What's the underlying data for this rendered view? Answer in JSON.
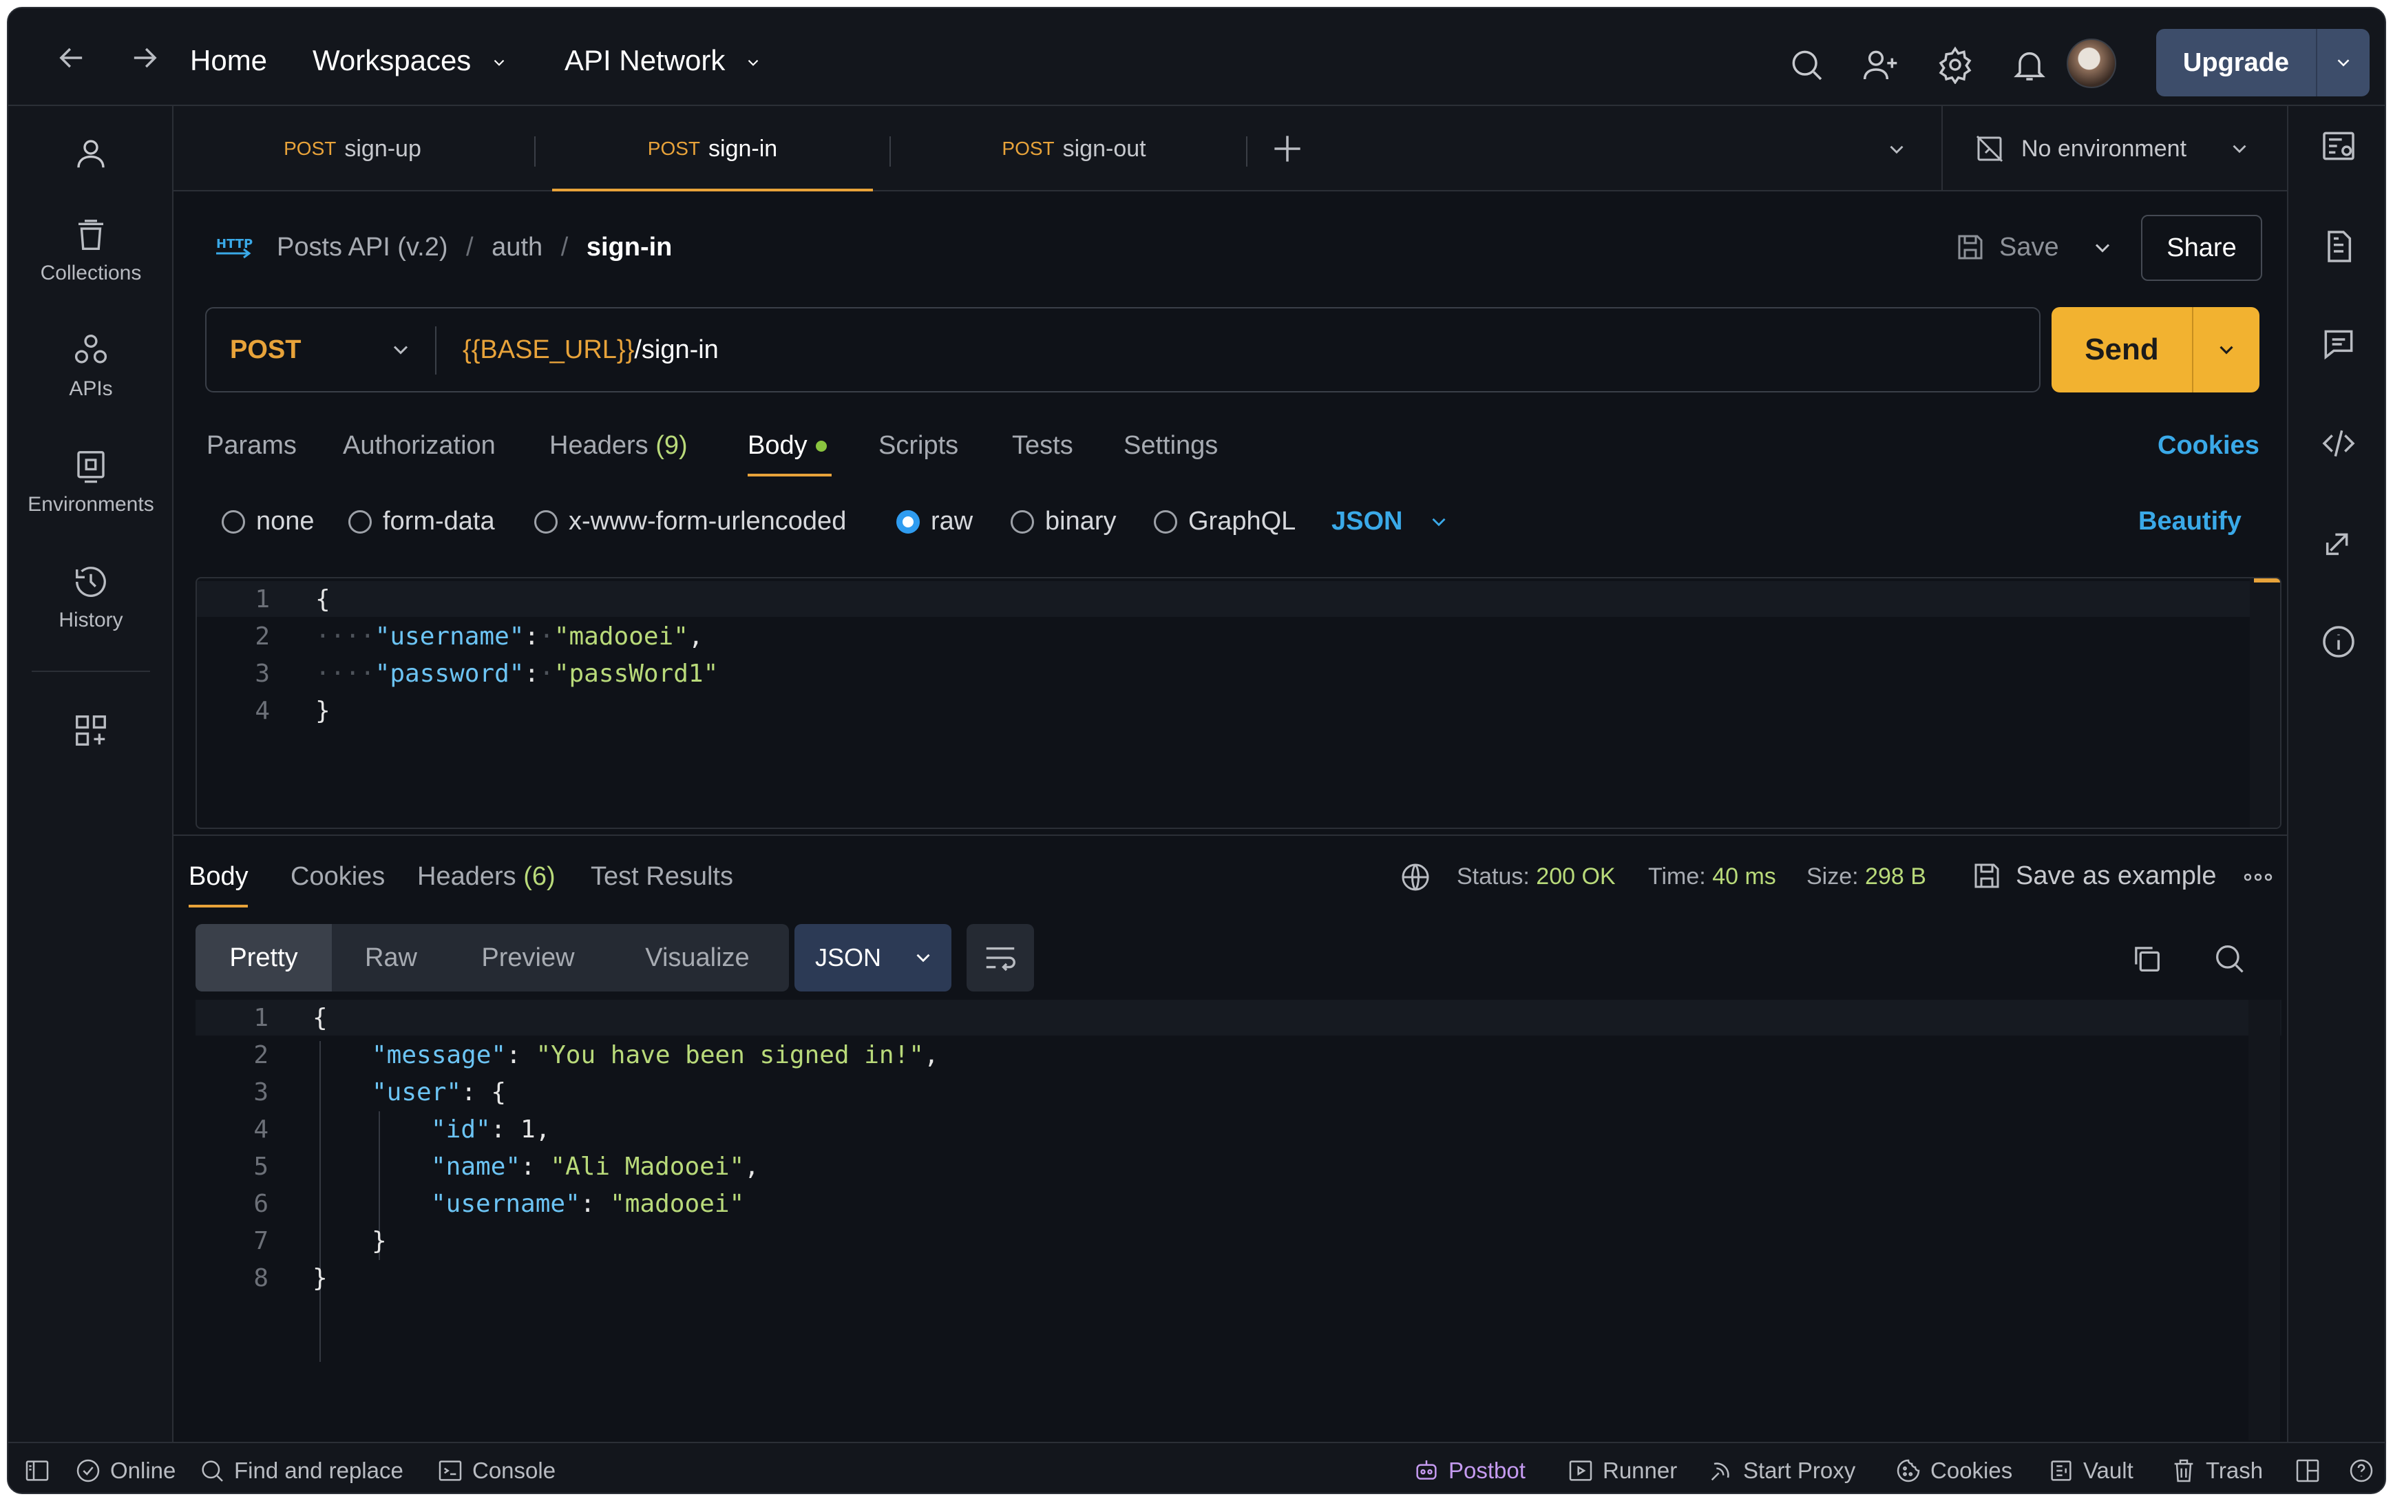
{
  "topbar": {
    "home": "Home",
    "workspaces": "Workspaces",
    "api_network": "API Network",
    "upgrade": "Upgrade"
  },
  "left_rail": {
    "collections": "Collections",
    "apis": "APIs",
    "environments": "Environments",
    "history": "History"
  },
  "tabs": [
    {
      "method": "POST",
      "name": "sign-up",
      "active": false
    },
    {
      "method": "POST",
      "name": "sign-in",
      "active": true
    },
    {
      "method": "POST",
      "name": "sign-out",
      "active": false
    }
  ],
  "environment": "No environment",
  "breadcrumb": {
    "badge": "HTTP",
    "collection": "Posts API (v.2)",
    "folder": "auth",
    "request": "sign-in",
    "sep": "/"
  },
  "actions": {
    "save": "Save",
    "share": "Share"
  },
  "request": {
    "method": "POST",
    "url_var": "{{BASE_URL}}",
    "url_path": "/sign-in",
    "send": "Send"
  },
  "request_tabs": {
    "params": "Params",
    "authorization": "Authorization",
    "headers": "Headers",
    "headers_count": "(9)",
    "body": "Body",
    "scripts": "Scripts",
    "tests": "Tests",
    "settings": "Settings",
    "cookies": "Cookies"
  },
  "body_modes": {
    "none": "none",
    "form_data": "form-data",
    "urlencoded": "x-www-form-urlencoded",
    "raw": "raw",
    "binary": "binary",
    "graphql": "GraphQL",
    "format": "JSON",
    "beautify": "Beautify"
  },
  "request_body": {
    "line_numbers": [
      "1",
      "2",
      "3",
      "4"
    ],
    "open": "{",
    "close": "}",
    "indent_dots": "····",
    "username_key": "\"username\"",
    "username_val": "\"madooei\"",
    "password_key": "\"password\"",
    "password_val": "\"passWord1\"",
    "colon": ":",
    "comma": ","
  },
  "response_tabs": {
    "body": "Body",
    "cookies": "Cookies",
    "headers": "Headers",
    "headers_count": "(6)",
    "test_results": "Test Results"
  },
  "response_meta": {
    "status_label": "Status:",
    "status_value": "200 OK",
    "time_label": "Time:",
    "time_value": "40 ms",
    "size_label": "Size:",
    "size_value": "298 B",
    "save_example": "Save as example"
  },
  "response_view": {
    "pretty": "Pretty",
    "raw": "Raw",
    "preview": "Preview",
    "visualize": "Visualize",
    "format": "JSON"
  },
  "response_body": {
    "line_numbers": [
      "1",
      "2",
      "3",
      "4",
      "5",
      "6",
      "7",
      "8"
    ],
    "l1": "{",
    "message_key": "\"message\"",
    "message_val": "\"You have been signed in!\"",
    "user_key": "\"user\"",
    "user_open": ": {",
    "id_key": "\"id\"",
    "id_val": ": 1,",
    "name_key": "\"name\"",
    "name_val": "\"Ali Madooei\"",
    "username_key": "\"username\"",
    "username_val": "\"madooei\"",
    "l7": "}",
    "l8": "}",
    "colon_sp": ": ",
    "comma": ","
  },
  "statusbar": {
    "online": "Online",
    "find_replace": "Find and replace",
    "console": "Console",
    "postbot": "Postbot",
    "runner": "Runner",
    "start_proxy": "Start Proxy",
    "cookies": "Cookies",
    "vault": "Vault",
    "trash": "Trash"
  },
  "colors": {
    "accent_orange": "#f2b230",
    "method_orange": "#e8a33a",
    "link_blue": "#3aa9e8",
    "status_green": "#b9da7a",
    "postbot_purple": "#c59af0"
  }
}
